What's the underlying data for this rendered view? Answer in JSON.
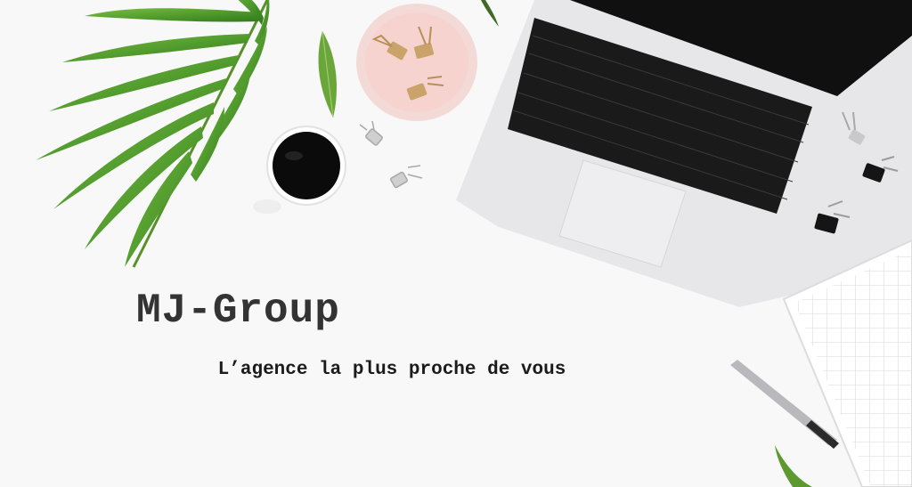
{
  "brand": {
    "name": "MJ-Group",
    "tagline": "L’agence la plus proche de vous"
  },
  "colors": {
    "background": "#f8f8f8",
    "text_title": "#333333",
    "text_tagline": "#1b1b1b",
    "leaf_green": "#4f9a2a",
    "pink_dish": "#f6d3cf",
    "laptop_silver": "#e7e7e9",
    "keyboard_black": "#1a1a1a"
  },
  "icons": [
    "palm-leaf-icon",
    "coffee-cup-icon",
    "pink-dish-icon",
    "binder-clip-icon",
    "laptop-icon",
    "notebook-icon",
    "pen-icon",
    "leaf-icon"
  ]
}
